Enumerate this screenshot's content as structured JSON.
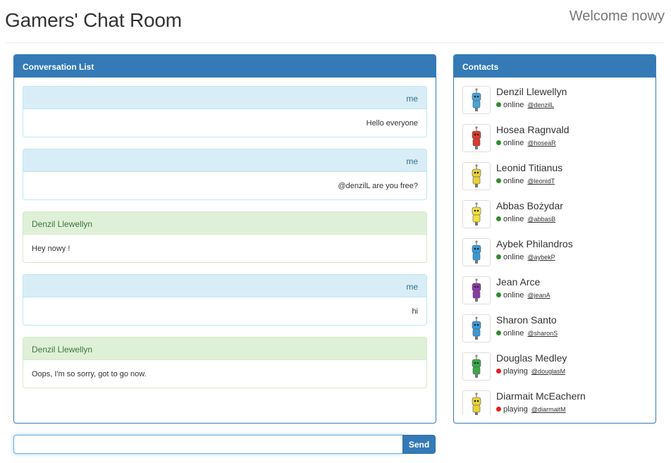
{
  "header": {
    "title": "Gamers' Chat Room",
    "welcome": "Welcome nowy"
  },
  "conversation": {
    "heading": "Conversation List",
    "messages": [
      {
        "author": "me",
        "text": "Hello everyone",
        "type": "me"
      },
      {
        "author": "me",
        "text": "@denzilL are you free?",
        "type": "me"
      },
      {
        "author": "Denzil Llewellyn",
        "text": "Hey nowy !",
        "type": "other"
      },
      {
        "author": "me",
        "text": "hi",
        "type": "me"
      },
      {
        "author": "Denzil Llewellyn",
        "text": "Oops, I'm so sorry, got to go now.",
        "type": "other"
      }
    ]
  },
  "contacts": {
    "heading": "Contacts",
    "items": [
      {
        "name": "Denzil Llewellyn",
        "status": "online",
        "handle": "@denzilL",
        "avatar_color": "#4aa3d8",
        "status_color": "#2e8b2e"
      },
      {
        "name": "Hosea Ragnvald",
        "status": "online",
        "handle": "@hoseaR",
        "avatar_color": "#d83a2e",
        "status_color": "#2e8b2e"
      },
      {
        "name": "Leonid Titianus",
        "status": "online",
        "handle": "@leonidT",
        "avatar_color": "#e8d23a",
        "status_color": "#2e8b2e"
      },
      {
        "name": "Abbas Bożydar",
        "status": "online",
        "handle": "@abbasB",
        "avatar_color": "#f0e040",
        "status_color": "#2e8b2e"
      },
      {
        "name": "Aybek Philandros",
        "status": "online",
        "handle": "@aybekP",
        "avatar_color": "#3a9ad8",
        "status_color": "#2e8b2e"
      },
      {
        "name": "Jean Arce",
        "status": "online",
        "handle": "@jeanA",
        "avatar_color": "#8a3aa8",
        "status_color": "#2e8b2e"
      },
      {
        "name": "Sharon Santo",
        "status": "online",
        "handle": "@sharonS",
        "avatar_color": "#3a9ad8",
        "status_color": "#2e8b2e"
      },
      {
        "name": "Douglas Medley",
        "status": "playing",
        "handle": "@douglasM",
        "avatar_color": "#3aa84a",
        "status_color": "#e02020"
      },
      {
        "name": "Diarmait McEachern",
        "status": "playing",
        "handle": "@diarmaitM",
        "avatar_color": "#e8d23a",
        "status_color": "#e02020"
      }
    ]
  },
  "composer": {
    "value": "",
    "send_label": "Send"
  }
}
